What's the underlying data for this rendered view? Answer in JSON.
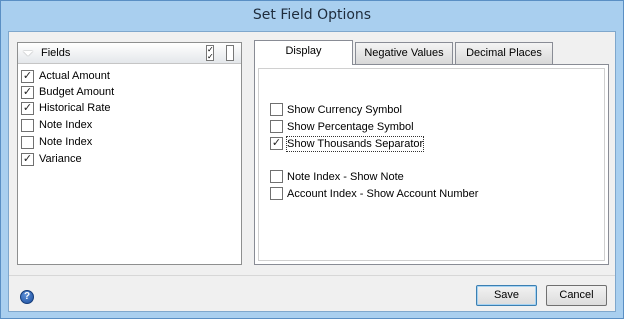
{
  "window": {
    "title": "Set Field Options"
  },
  "fields_panel": {
    "header": "Fields",
    "check_all_icon": "check-all-icon",
    "uncheck_all_icon": "uncheck-all-icon",
    "items": [
      {
        "label": "Actual Amount",
        "checked": true
      },
      {
        "label": "Budget Amount",
        "checked": true
      },
      {
        "label": "Historical Rate",
        "checked": true
      },
      {
        "label": "Note Index",
        "checked": false
      },
      {
        "label": "Note Index",
        "checked": false
      },
      {
        "label": "Variance",
        "checked": true
      }
    ]
  },
  "tabs": [
    {
      "label": "Display",
      "active": true
    },
    {
      "label": "Negative Values",
      "active": false
    },
    {
      "label": "Decimal Places",
      "active": false
    }
  ],
  "display_options": [
    {
      "label": "Show Currency Symbol",
      "checked": false
    },
    {
      "label": "Show Percentage Symbol",
      "checked": false
    },
    {
      "label": "Show Thousands Separator",
      "checked": true
    },
    {
      "label": "Note Index - Show Note",
      "checked": false
    },
    {
      "label": "Account Index - Show Account Number",
      "checked": false
    }
  ],
  "footer": {
    "help_icon": "help-icon",
    "save_label": "Save",
    "cancel_label": "Cancel"
  }
}
